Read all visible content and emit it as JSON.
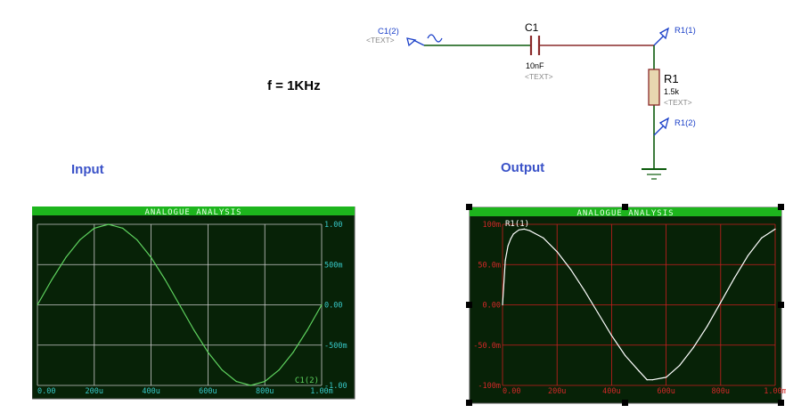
{
  "frequency_label": "f = 1KHz",
  "input_heading": "Input",
  "output_heading": "Output",
  "schematic": {
    "source_label": "C1(2)",
    "source_sub": "<TEXT>",
    "cap_name": "C1",
    "cap_value": "10nF",
    "cap_sub": "<TEXT>",
    "res_name": "R1",
    "res_value": "1.5k",
    "res_sub": "<TEXT>",
    "probe_top": "R1(1)",
    "probe_bottom": "R1(2)"
  },
  "graphs": {
    "input": {
      "title": "ANALOGUE ANALYSIS",
      "trace": "C1(2)",
      "x_ticks": [
        "0.00",
        "200u",
        "400u",
        "600u",
        "800u",
        "1.00m"
      ],
      "y_ticks": [
        "1.00",
        "500m",
        "0.00",
        "-500m",
        "-1.00"
      ]
    },
    "output": {
      "title": "ANALOGUE ANALYSIS",
      "trace": "R1(1)",
      "x_ticks": [
        "0.00",
        "200u",
        "400u",
        "600u",
        "800u",
        "1.00m"
      ],
      "y_ticks": [
        "100m",
        "50.0m",
        "0.00",
        "-50.0m",
        "-100m"
      ]
    }
  },
  "chart_data": [
    {
      "type": "line",
      "title": "ANALOGUE ANALYSIS",
      "series": [
        {
          "name": "C1(2)",
          "x": [
            0,
            5e-05,
            0.0001,
            0.00015,
            0.0002,
            0.00025,
            0.0003,
            0.00035,
            0.0004,
            0.00045,
            0.0005,
            0.00055,
            0.0006,
            0.00065,
            0.0007,
            0.00075,
            0.0008,
            0.00085,
            0.0009,
            0.00095,
            0.001
          ],
          "y": [
            0,
            0.309,
            0.588,
            0.809,
            0.951,
            1,
            0.951,
            0.809,
            0.588,
            0.309,
            0,
            -0.309,
            -0.588,
            -0.809,
            -0.951,
            -1,
            -0.951,
            -0.809,
            -0.588,
            -0.309,
            0
          ]
        }
      ],
      "xlim": [
        0,
        0.001
      ],
      "ylim": [
        -1,
        1
      ],
      "grid": true,
      "colors": {
        "background": "#072207",
        "grid": "#c8c8c8",
        "trace": "#5fd35f",
        "titlebar": "#1db51d",
        "axis_text": "#37c8c8"
      }
    },
    {
      "type": "line",
      "title": "ANALOGUE ANALYSIS",
      "series": [
        {
          "name": "R1(1)",
          "x": [
            0,
            1e-05,
            2e-05,
            3e-05,
            4e-05,
            6e-05,
            8e-05,
            0.0001,
            0.00015,
            0.0002,
            0.00025,
            0.0003,
            0.00035,
            0.0004,
            0.00045,
            0.0005,
            0.00053,
            0.00055,
            0.0006,
            0.00065,
            0.0007,
            0.00075,
            0.0008,
            0.00085,
            0.0009,
            0.00095,
            0.001
          ],
          "y": [
            0,
            0.055,
            0.073,
            0.082,
            0.088,
            0.093,
            0.094,
            0.092,
            0.083,
            0.066,
            0.044,
            0.018,
            -0.01,
            -0.038,
            -0.063,
            -0.082,
            -0.093,
            -0.093,
            -0.09,
            -0.075,
            -0.053,
            -0.027,
            0.003,
            0.033,
            0.061,
            0.083,
            0.094
          ]
        }
      ],
      "xlim": [
        0,
        0.001
      ],
      "ylim": [
        -0.1,
        0.1
      ],
      "grid": true,
      "colors": {
        "background": "#072207",
        "grid": "#c81e1e",
        "trace": "#ffffff",
        "titlebar": "#1db51d",
        "axis_text": "#d22828"
      }
    }
  ]
}
